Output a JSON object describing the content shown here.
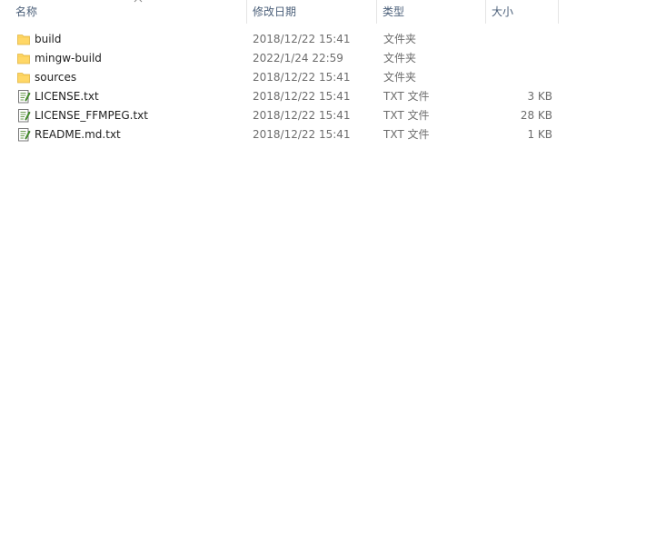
{
  "columns": {
    "name": "名称",
    "date": "修改日期",
    "type": "类型",
    "size": "大小"
  },
  "sort": {
    "column": "name",
    "direction": "ascending",
    "icon": "chevron-up-icon"
  },
  "files": [
    {
      "name": "build",
      "date": "2018/12/22 15:41",
      "type": "文件夹",
      "size": "",
      "icon": "folder-icon"
    },
    {
      "name": "mingw-build",
      "date": "2022/1/24 22:59",
      "type": "文件夹",
      "size": "",
      "icon": "folder-icon"
    },
    {
      "name": "sources",
      "date": "2018/12/22 15:41",
      "type": "文件夹",
      "size": "",
      "icon": "folder-icon"
    },
    {
      "name": "LICENSE.txt",
      "date": "2018/12/22 15:41",
      "type": "TXT 文件",
      "size": "3 KB",
      "icon": "text-file-icon"
    },
    {
      "name": "LICENSE_FFMPEG.txt",
      "date": "2018/12/22 15:41",
      "type": "TXT 文件",
      "size": "28 KB",
      "icon": "text-file-icon"
    },
    {
      "name": "README.md.txt",
      "date": "2018/12/22 15:41",
      "type": "TXT 文件",
      "size": "1 KB",
      "icon": "text-file-icon"
    }
  ],
  "colors": {
    "header_text": "#4c607a",
    "folder": "#ffd766",
    "meta_text": "#6d6d6d"
  }
}
